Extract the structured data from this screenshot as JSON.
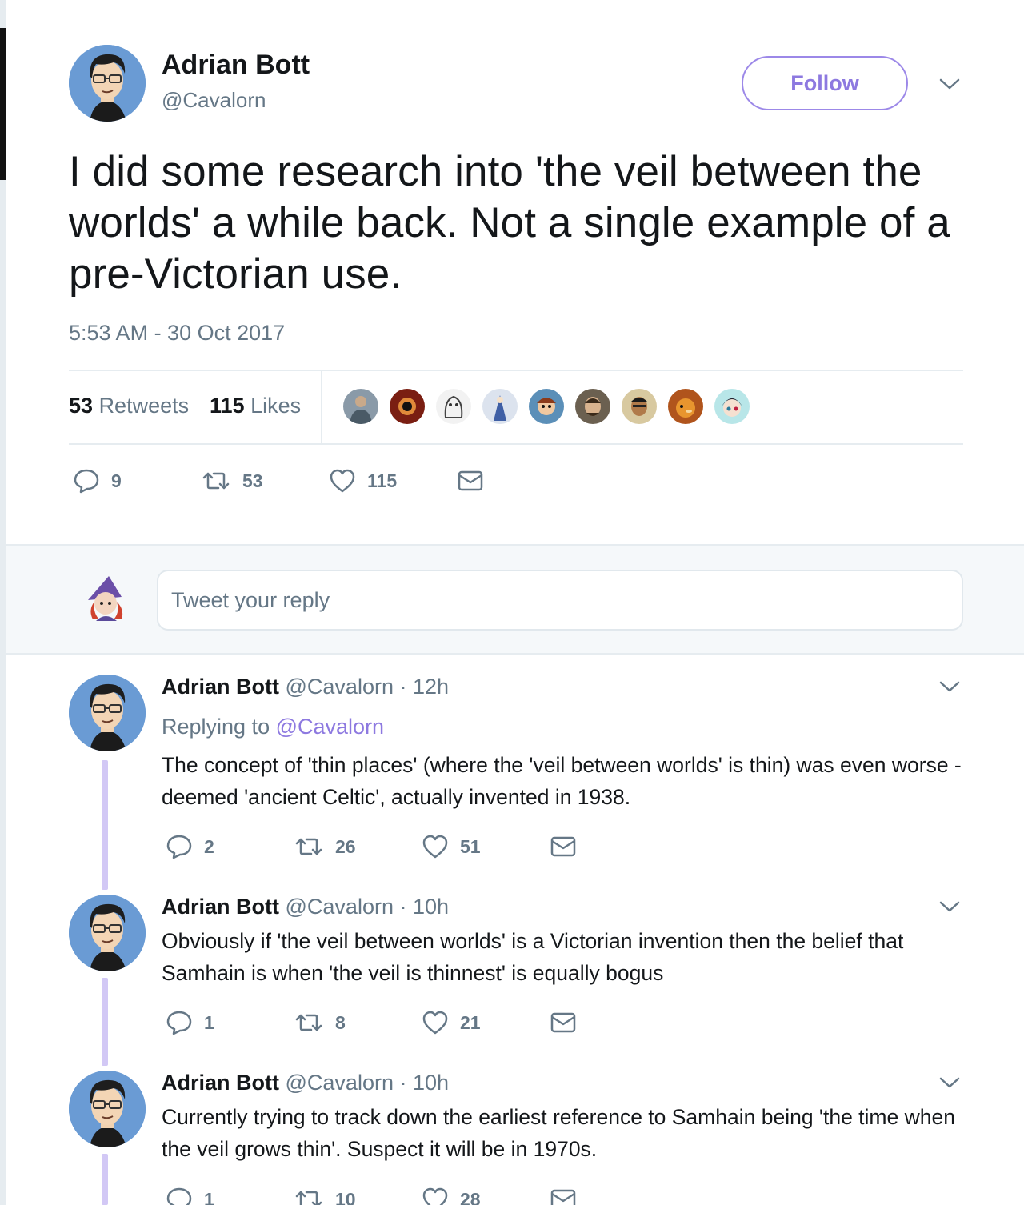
{
  "main_tweet": {
    "author_name": "Adrian Bott",
    "author_handle": "@Cavalorn",
    "follow_label": "Follow",
    "text": "I did some research into 'the veil between the worlds' a while back. Not a single example of a pre-Victorian use.",
    "timestamp": "5:53 AM - 30 Oct 2017",
    "stats": {
      "retweets_count": "53",
      "retweets_label": "Retweets",
      "likes_count": "115",
      "likes_label": "Likes"
    },
    "actions": {
      "replies": "9",
      "retweets": "53",
      "likes": "115"
    }
  },
  "reply_box": {
    "placeholder": "Tweet your reply"
  },
  "replies": [
    {
      "name": "Adrian Bott",
      "handle": "@Cavalorn",
      "time": "· 12h",
      "replying_to_label": "Replying to",
      "replying_to_handle": "@Cavalorn",
      "text": "The concept of 'thin places' (where the 'veil between worlds' is thin) was even worse - deemed 'ancient Celtic', actually invented in 1938.",
      "replies": "2",
      "retweets": "26",
      "likes": "51"
    },
    {
      "name": "Adrian Bott",
      "handle": "@Cavalorn",
      "time": "· 10h",
      "text": "Obviously if 'the veil between worlds' is a Victorian invention then the belief that Samhain is when 'the veil is thinnest' is equally bogus",
      "replies": "1",
      "retweets": "8",
      "likes": "21"
    },
    {
      "name": "Adrian Bott",
      "handle": "@Cavalorn",
      "time": "· 10h",
      "text": "Currently trying to track down the earliest reference to Samhain being 'the time when the veil grows thin'. Suspect it will be in 1970s.",
      "replies": "1",
      "retweets": "10",
      "likes": "28"
    }
  ],
  "colors": {
    "accent": "#8d79e0",
    "thread_line": "#d2c8f5",
    "secondary_text": "#657786",
    "avatar_bg": "#6a9bd4"
  }
}
